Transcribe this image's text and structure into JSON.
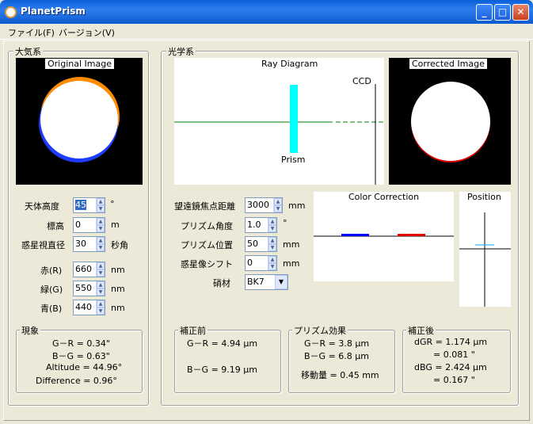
{
  "window": {
    "title": "PlanetPrism",
    "min": "_",
    "max": "□",
    "close": "✕"
  },
  "menu": {
    "file": "ファイル(F)",
    "version": "バージョン(V)"
  },
  "atmo": {
    "title": "大気系",
    "original_caption": "Original Image",
    "altitude_label": "天体高度",
    "altitude_value": "45",
    "altitude_unit": "°",
    "elevation_label": "標高",
    "elevation_value": "0",
    "elevation_unit": "m",
    "diameter_label": "惑星視直径",
    "diameter_value": "30",
    "diameter_unit": "秒角",
    "red_label": "赤(R)",
    "red_value": "660",
    "red_unit": "nm",
    "green_label": "緑(G)",
    "green_value": "550",
    "green_unit": "nm",
    "blue_label": "青(B)",
    "blue_value": "440",
    "blue_unit": "nm",
    "phenomena_title": "現象",
    "phen_gr": "G－R = 0.34\"",
    "phen_bg": "B－G = 0.63\"",
    "phen_alt": "Altitude = 44.96°",
    "phen_diff": "Difference = 0.96°"
  },
  "optics": {
    "title": "光学系",
    "ray_caption": "Ray Diagram",
    "ccd_label": "CCD",
    "prism_label": "Prism",
    "corrected_caption": "Corrected Image",
    "focal_label": "望遠鏡焦点距離",
    "focal_value": "3000",
    "focal_unit": "mm",
    "angle_label": "プリズム角度",
    "angle_value": "1.0",
    "angle_unit": "°",
    "position_label": "プリズム位置",
    "position_value": "50",
    "position_unit": "mm",
    "shift_label": "惑星像シフト",
    "shift_value": "0",
    "shift_unit": "mm",
    "glass_label": "硝材",
    "glass_value": "BK7",
    "color_caption": "Color Correction",
    "position_caption": "Position",
    "before_title": "補正前",
    "before_gr": "G－R = 4.94 μm",
    "before_bg": "B－G = 9.19 μm",
    "prism_effect_title": "プリズム効果",
    "pe_gr": "G－R = 3.8 μm",
    "pe_bg": "B－G = 6.8 μm",
    "pe_move": "移動量 = 0.45 mm",
    "after_title": "補正後",
    "after_dgr": "dGR = 1.174 μm",
    "after_dgr2": "= 0.081 \"",
    "after_dbg": "dBG = 2.424 μm",
    "after_dbg2": "= 0.167 \""
  },
  "colors": {
    "cyan": "#00ffff",
    "green_line": "#008000",
    "red": "#e00000",
    "blue": "#0000ff",
    "orange": "#ff8c00"
  }
}
